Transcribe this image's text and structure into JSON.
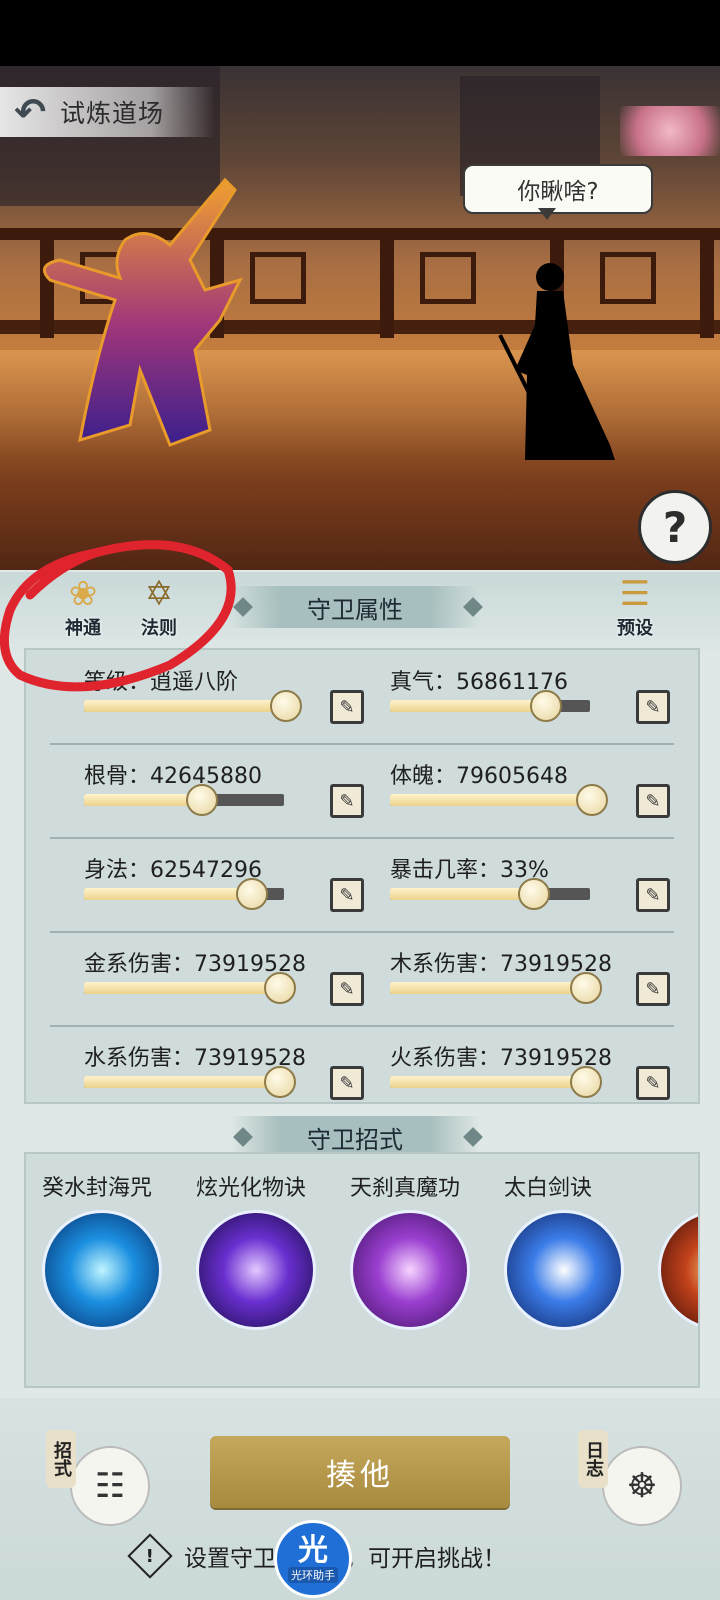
{
  "header": {
    "title": "试炼道场"
  },
  "scene": {
    "speech": "你瞅啥?",
    "help_glyph": "?"
  },
  "tabs": [
    {
      "label": "神通"
    },
    {
      "label": "法则"
    },
    {
      "label": "预设"
    }
  ],
  "attributes": {
    "title": "守卫属性",
    "rows": [
      {
        "left": {
          "label": "等级：逍遥八阶",
          "level": 1.0
        },
        "right": {
          "label": "真气：56861176",
          "level": 0.77
        }
      },
      {
        "left": {
          "label": "根骨：42645880",
          "level": 0.58
        },
        "right": {
          "label": "体魄：79605648",
          "level": 1.0
        }
      },
      {
        "left": {
          "label": "身法：62547296",
          "level": 0.83
        },
        "right": {
          "label": "暴击几率：33%",
          "level": 0.71
        }
      },
      {
        "left": {
          "label": "金系伤害：73919528",
          "level": 0.97
        },
        "right": {
          "label": "木系伤害：73919528",
          "level": 0.97
        }
      },
      {
        "left": {
          "label": "水系伤害：73919528",
          "level": 0.97
        },
        "right": {
          "label": "火系伤害：73919528",
          "level": 0.97
        }
      }
    ]
  },
  "skills": {
    "title": "守卫招式",
    "items": [
      {
        "name": "癸水封海咒",
        "colors": [
          "#bff4ff",
          "#1b8fe0",
          "#052a66"
        ]
      },
      {
        "name": "炫光化物诀",
        "colors": [
          "#e3c8ff",
          "#6a2fd0",
          "#120a3c"
        ]
      },
      {
        "name": "天刹真魔功",
        "colors": [
          "#f6d4ff",
          "#9a3fd0",
          "#3a0f5c"
        ]
      },
      {
        "name": "太白剑诀",
        "colors": [
          "#ffffff",
          "#3b7ce8",
          "#0c1e5a"
        ]
      },
      {
        "name": "",
        "colors": [
          "#ffd27a",
          "#c3421c",
          "#3a0d05"
        ]
      }
    ]
  },
  "actions": {
    "fight_label": "揍他",
    "left_tag": "招式",
    "right_tag": "日志",
    "hint": "设置守卫招式后，可开启挑战！",
    "hint_icon": "!"
  },
  "overlay": {
    "badge_big": "光",
    "badge_small": "光环助手"
  },
  "colors": {
    "annotation_red": "#e0242e",
    "fight_gold": "#b8994c"
  }
}
